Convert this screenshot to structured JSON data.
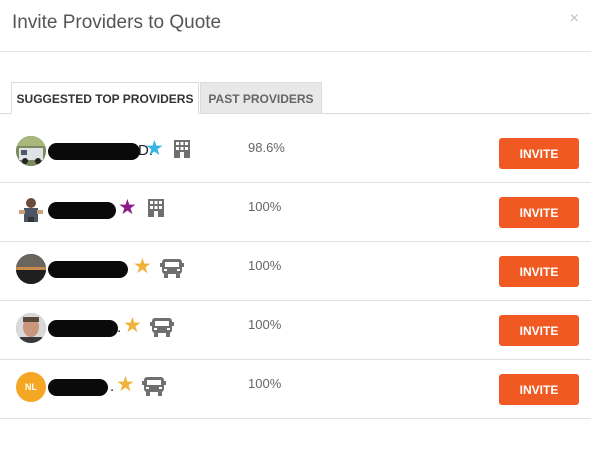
{
  "modal": {
    "title": "Invite Providers to Quote",
    "close_glyph": "×"
  },
  "tabs": [
    {
      "label": "SUGGESTED TOP PROVIDERS",
      "active": true
    },
    {
      "label": "PAST PROVIDERS",
      "active": false
    }
  ],
  "colors": {
    "invite_button": "#f05a22",
    "star_blue": "#3ab4e6",
    "star_purple": "#8b1a8b",
    "star_gold": "#f0b23b"
  },
  "providers": [
    {
      "suffix": "D.",
      "star_color": "blue",
      "type_icon": "building-icon",
      "score": "98.6%",
      "invite_label": "INVITE"
    },
    {
      "suffix": "",
      "star_color": "purple",
      "type_icon": "building-icon",
      "score": "100%",
      "invite_label": "INVITE"
    },
    {
      "suffix": "",
      "star_color": "gold",
      "type_icon": "truck-icon",
      "score": "100%",
      "invite_label": "INVITE"
    },
    {
      "suffix": ".",
      "star_color": "gold",
      "type_icon": "truck-icon",
      "score": "100%",
      "invite_label": "INVITE"
    },
    {
      "avatar_initials": "NL",
      "suffix": ".",
      "star_color": "gold",
      "type_icon": "truck-icon",
      "score": "100%",
      "invite_label": "INVITE"
    }
  ]
}
